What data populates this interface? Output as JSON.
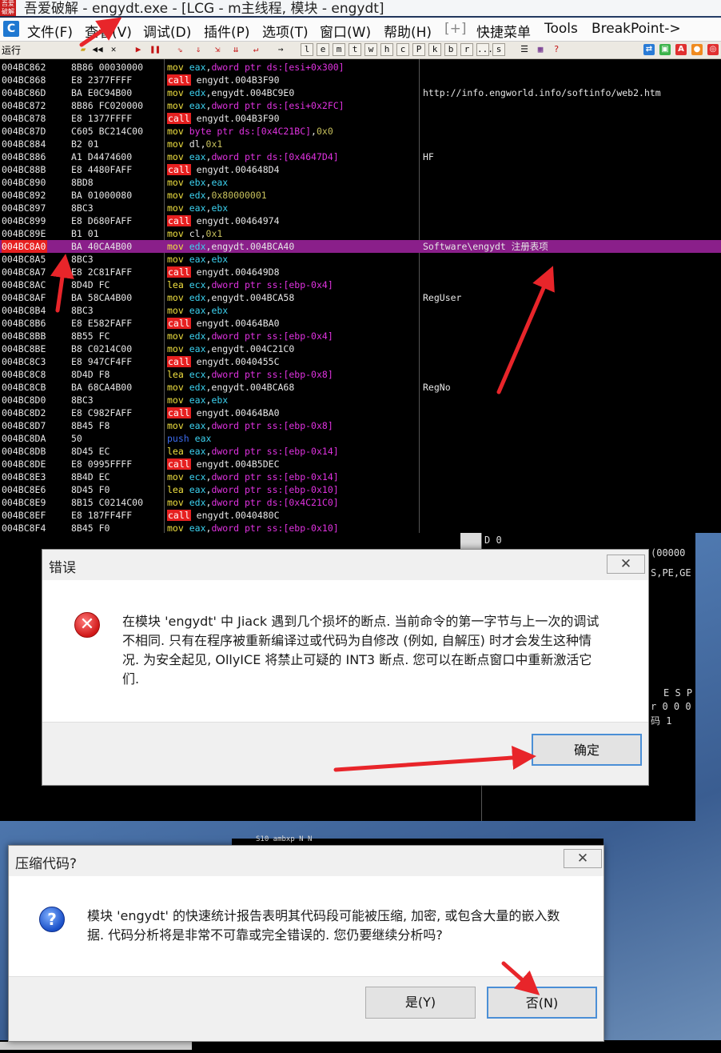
{
  "window": {
    "app_icon_text": "吾爱破解",
    "title": "吾爱破解 - engydt.exe - [LCG - m主线程, 模块 - engydt]"
  },
  "menu": {
    "items": [
      "文件(F)",
      "查看(V)",
      "调试(D)",
      "插件(P)",
      "选项(T)",
      "窗口(W)",
      "帮助(H)",
      "[+]",
      "快捷菜单",
      "Tools",
      "BreakPoint->"
    ]
  },
  "toolbar": {
    "status": "运行",
    "letter_buttons": [
      "l",
      "e",
      "m",
      "t",
      "w",
      "h",
      "c",
      "P",
      "k",
      "b",
      "r",
      "...",
      "s"
    ]
  },
  "disasm": {
    "rows": [
      {
        "addr": "004BC862",
        "hex": "8B86 00030000",
        "m": "mov",
        "ops": [
          [
            "rg",
            "eax"
          ],
          [
            "t",
            ","
          ],
          [
            "ptr",
            "dword ptr ds:[esi+0x300]"
          ]
        ],
        "cmt": ""
      },
      {
        "addr": "004BC868",
        "hex": "E8 2377FFFF",
        "m": "call",
        "ops": [
          [
            "t",
            "engydt.004B3F90"
          ]
        ],
        "cmt": ""
      },
      {
        "addr": "004BC86D",
        "hex": "BA E0C94B00",
        "m": "mov",
        "ops": [
          [
            "rg",
            "edx"
          ],
          [
            "t",
            ",engydt.004BC9E0"
          ]
        ],
        "cmt": "http://info.engworld.info/softinfo/web2.htm"
      },
      {
        "addr": "004BC872",
        "hex": "8B86 FC020000",
        "m": "mov",
        "ops": [
          [
            "rg",
            "eax"
          ],
          [
            "t",
            ","
          ],
          [
            "ptr",
            "dword ptr ds:[esi+0x2FC]"
          ]
        ],
        "cmt": ""
      },
      {
        "addr": "004BC878",
        "hex": "E8 1377FFFF",
        "m": "call",
        "ops": [
          [
            "t",
            "engydt.004B3F90"
          ]
        ],
        "cmt": ""
      },
      {
        "addr": "004BC87D",
        "hex": "C605 BC214C00",
        "m": "mov",
        "ops": [
          [
            "ptr",
            "byte ptr ds:[0x4C21BC]"
          ],
          [
            "t",
            ","
          ],
          [
            "num",
            "0x0"
          ]
        ],
        "cmt": ""
      },
      {
        "addr": "004BC884",
        "hex": "B2 01",
        "m": "mov",
        "ops": [
          [
            "t",
            "dl"
          ],
          [
            "t",
            ","
          ],
          [
            "num",
            "0x1"
          ]
        ],
        "cmt": ""
      },
      {
        "addr": "004BC886",
        "hex": "A1 D4474600",
        "m": "mov",
        "ops": [
          [
            "rg",
            "eax"
          ],
          [
            "t",
            ","
          ],
          [
            "ptr",
            "dword ptr ds:[0x4647D4]"
          ]
        ],
        "cmt": " HF"
      },
      {
        "addr": "004BC88B",
        "hex": "E8 4480FAFF",
        "m": "call",
        "ops": [
          [
            "t",
            "engydt.004648D4"
          ]
        ],
        "cmt": ""
      },
      {
        "addr": "004BC890",
        "hex": "8BD8",
        "m": "mov",
        "ops": [
          [
            "rg",
            "ebx"
          ],
          [
            "t",
            ","
          ],
          [
            "rg",
            "eax"
          ]
        ],
        "cmt": ""
      },
      {
        "addr": "004BC892",
        "hex": "BA 01000080",
        "m": "mov",
        "ops": [
          [
            "rg",
            "edx"
          ],
          [
            "t",
            ","
          ],
          [
            "num",
            "0x80000001"
          ]
        ],
        "cmt": ""
      },
      {
        "addr": "004BC897",
        "hex": "8BC3",
        "m": "mov",
        "ops": [
          [
            "rg",
            "eax"
          ],
          [
            "t",
            ","
          ],
          [
            "rg",
            "ebx"
          ]
        ],
        "cmt": ""
      },
      {
        "addr": "004BC899",
        "hex": "E8 D680FAFF",
        "m": "call",
        "ops": [
          [
            "t",
            "engydt.00464974"
          ]
        ],
        "cmt": ""
      },
      {
        "addr": "004BC89E",
        "hex": "B1 01",
        "m": "mov",
        "ops": [
          [
            "t",
            "cl"
          ],
          [
            "t",
            ","
          ],
          [
            "num",
            "0x1"
          ]
        ],
        "cmt": ""
      },
      {
        "addr": "004BC8A0",
        "hex": "BA 40CA4B00",
        "m": "mov",
        "ops": [
          [
            "rg",
            "edx"
          ],
          [
            "t",
            ",engydt.004BCA40"
          ]
        ],
        "cmt": "Software\\engydt 注册表项",
        "sel": true
      },
      {
        "addr": "004BC8A5",
        "hex": "8BC3",
        "m": "mov",
        "ops": [
          [
            "rg",
            "eax"
          ],
          [
            "t",
            ","
          ],
          [
            "rg",
            "ebx"
          ]
        ],
        "cmt": ""
      },
      {
        "addr": "004BC8A7",
        "hex": "E8 2C81FAFF",
        "m": "call",
        "ops": [
          [
            "t",
            "engydt.004649D8"
          ]
        ],
        "cmt": ""
      },
      {
        "addr": "004BC8AC",
        "hex": "8D4D FC",
        "m": "lea",
        "ops": [
          [
            "rg",
            "ecx"
          ],
          [
            "t",
            ","
          ],
          [
            "ptr",
            "dword ptr ss:[ebp-0x4]"
          ]
        ],
        "cmt": ""
      },
      {
        "addr": "004BC8AF",
        "hex": "BA 58CA4B00",
        "m": "mov",
        "ops": [
          [
            "rg",
            "edx"
          ],
          [
            "t",
            ",engydt.004BCA58"
          ]
        ],
        "cmt": "RegUser"
      },
      {
        "addr": "004BC8B4",
        "hex": "8BC3",
        "m": "mov",
        "ops": [
          [
            "rg",
            "eax"
          ],
          [
            "t",
            ","
          ],
          [
            "rg",
            "ebx"
          ]
        ],
        "cmt": ""
      },
      {
        "addr": "004BC8B6",
        "hex": "E8 E582FAFF",
        "m": "call",
        "ops": [
          [
            "t",
            "engydt.00464BA0"
          ]
        ],
        "cmt": ""
      },
      {
        "addr": "004BC8BB",
        "hex": "8B55 FC",
        "m": "mov",
        "ops": [
          [
            "rg",
            "edx"
          ],
          [
            "t",
            ","
          ],
          [
            "ptr",
            "dword ptr ss:[ebp-0x4]"
          ]
        ],
        "cmt": ""
      },
      {
        "addr": "004BC8BE",
        "hex": "B8 C0214C00",
        "m": "mov",
        "ops": [
          [
            "rg",
            "eax"
          ],
          [
            "t",
            ",engydt.004C21C0"
          ]
        ],
        "cmt": ""
      },
      {
        "addr": "004BC8C3",
        "hex": "E8 947CF4FF",
        "m": "call",
        "ops": [
          [
            "t",
            "engydt.0040455C"
          ]
        ],
        "cmt": ""
      },
      {
        "addr": "004BC8C8",
        "hex": "8D4D F8",
        "m": "lea",
        "ops": [
          [
            "rg",
            "ecx"
          ],
          [
            "t",
            ","
          ],
          [
            "ptr",
            "dword ptr ss:[ebp-0x8]"
          ]
        ],
        "cmt": ""
      },
      {
        "addr": "004BC8CB",
        "hex": "BA 68CA4B00",
        "m": "mov",
        "ops": [
          [
            "rg",
            "edx"
          ],
          [
            "t",
            ",engydt.004BCA68"
          ]
        ],
        "cmt": "RegNo"
      },
      {
        "addr": "004BC8D0",
        "hex": "8BC3",
        "m": "mov",
        "ops": [
          [
            "rg",
            "eax"
          ],
          [
            "t",
            ","
          ],
          [
            "rg",
            "ebx"
          ]
        ],
        "cmt": ""
      },
      {
        "addr": "004BC8D2",
        "hex": "E8 C982FAFF",
        "m": "call",
        "ops": [
          [
            "t",
            "engydt.00464BA0"
          ]
        ],
        "cmt": ""
      },
      {
        "addr": "004BC8D7",
        "hex": "8B45 F8",
        "m": "mov",
        "ops": [
          [
            "rg",
            "eax"
          ],
          [
            "t",
            ","
          ],
          [
            "ptr",
            "dword ptr ss:[ebp-0x8]"
          ]
        ],
        "cmt": ""
      },
      {
        "addr": "004BC8DA",
        "hex": "50",
        "m": "push",
        "ops": [
          [
            "rg",
            "eax"
          ]
        ],
        "cmt": ""
      },
      {
        "addr": "004BC8DB",
        "hex": "8D45 EC",
        "m": "lea",
        "ops": [
          [
            "rg",
            "eax"
          ],
          [
            "t",
            ","
          ],
          [
            "ptr",
            "dword ptr ss:[ebp-0x14]"
          ]
        ],
        "cmt": ""
      },
      {
        "addr": "004BC8DE",
        "hex": "E8 0995FFFF",
        "m": "call",
        "ops": [
          [
            "t",
            "engydt.004B5DEC"
          ]
        ],
        "cmt": ""
      },
      {
        "addr": "004BC8E3",
        "hex": "8B4D EC",
        "m": "mov",
        "ops": [
          [
            "rg",
            "ecx"
          ],
          [
            "t",
            ","
          ],
          [
            "ptr",
            "dword ptr ss:[ebp-0x14]"
          ]
        ],
        "cmt": ""
      },
      {
        "addr": "004BC8E6",
        "hex": "8D45 F0",
        "m": "lea",
        "ops": [
          [
            "rg",
            "eax"
          ],
          [
            "t",
            ","
          ],
          [
            "ptr",
            "dword ptr ss:[ebp-0x10]"
          ]
        ],
        "cmt": ""
      },
      {
        "addr": "004BC8E9",
        "hex": "8B15 C0214C00",
        "m": "mov",
        "ops": [
          [
            "rg",
            "edx"
          ],
          [
            "t",
            ","
          ],
          [
            "ptr",
            "dword ptr ds:[0x4C21C0]"
          ]
        ],
        "cmt": ""
      },
      {
        "addr": "004BC8EF",
        "hex": "E8 187FF4FF",
        "m": "call",
        "ops": [
          [
            "t",
            "engydt.0040480C"
          ]
        ],
        "cmt": ""
      },
      {
        "addr": "004BC8F4",
        "hex": "8B45 F0",
        "m": "mov",
        "ops": [
          [
            "rg",
            "eax"
          ],
          [
            "t",
            ","
          ],
          [
            "ptr",
            "dword ptr ss:[ebp-0x10]"
          ]
        ],
        "cmt": ""
      }
    ]
  },
  "background_fragments": {
    "dump_top": "D 0",
    "right1": "(00000",
    "right2": "S,PE,GE",
    "right3": "E S P",
    "right4": "r 0 0 0",
    "right5": "码    1",
    "bottom_strip": "S10 ambxp N N"
  },
  "error_dialog": {
    "title": "错误",
    "message": "在模块 'engydt' 中 Jiack   遇到几个损坏的断点. 当前命令的第一字节与上一次的调试不相同. 只有在程序被重新编译过或代码为自修改 (例如, 自解压) 时才会发生这种情况. 为安全起见, OllyICE 将禁止可疑的 INT3 断点. 您可以在断点窗口中重新激活它们.",
    "ok_button": "确定"
  },
  "compress_dialog": {
    "title": "压缩代码?",
    "message": "模块 'engydt' 的快速统计报告表明其代码段可能被压缩, 加密, 或包含大量的嵌入数据. 代码分析将是非常不可靠或完全错误的. 您仍要继续分析吗?",
    "yes_button": "是(Y)",
    "no_button": "否(N)"
  },
  "colors": {
    "selected_row": "#8a1f8a",
    "call_bg": "#e62020",
    "mnemonic": "#f0e040",
    "register": "#3cd2f0",
    "pointer": "#e032e0",
    "number": "#c7c05c",
    "annotation_arrow": "#e8252a"
  }
}
